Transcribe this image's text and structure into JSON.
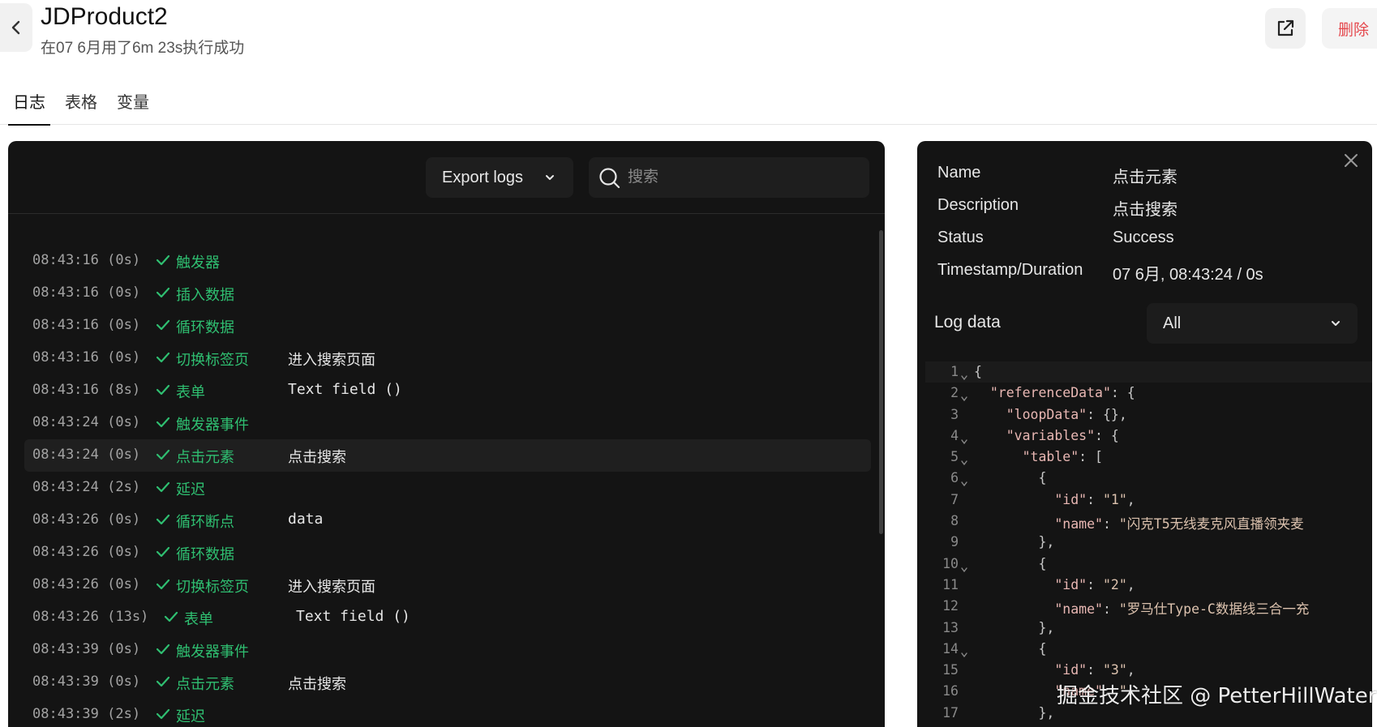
{
  "header": {
    "title": "JDProduct2",
    "subtitle": "在07 6月用了6m 23s执行成功",
    "delete_label": "删除"
  },
  "tabs": [
    {
      "label": "日志",
      "active": true
    },
    {
      "label": "表格",
      "active": false
    },
    {
      "label": "变量",
      "active": false
    }
  ],
  "log_panel": {
    "export_label": "Export logs",
    "search_placeholder": "搜索",
    "rows": [
      {
        "time": "08:43:16 (0s)",
        "step": "触发器",
        "detail": ""
      },
      {
        "time": "08:43:16 (0s)",
        "step": "插入数据",
        "detail": ""
      },
      {
        "time": "08:43:16 (0s)",
        "step": "循环数据",
        "detail": ""
      },
      {
        "time": "08:43:16 (0s)",
        "step": "切换标签页",
        "detail": "进入搜索页面"
      },
      {
        "time": "08:43:16 (8s)",
        "step": "表单",
        "detail": "Text field ()"
      },
      {
        "time": "08:43:24 (0s)",
        "step": "触发器事件",
        "detail": ""
      },
      {
        "time": "08:43:24 (0s)",
        "step": "点击元素",
        "detail": "点击搜索",
        "selected": true
      },
      {
        "time": "08:43:24 (2s)",
        "step": "延迟",
        "detail": ""
      },
      {
        "time": "08:43:26 (0s)",
        "step": "循环断点",
        "detail": "data"
      },
      {
        "time": "08:43:26 (0s)",
        "step": "循环数据",
        "detail": ""
      },
      {
        "time": "08:43:26 (0s)",
        "step": "切换标签页",
        "detail": "进入搜索页面"
      },
      {
        "time": "08:43:26 (13s)",
        "step": "表单",
        "detail": "Text field ()"
      },
      {
        "time": "08:43:39 (0s)",
        "step": "触发器事件",
        "detail": ""
      },
      {
        "time": "08:43:39 (0s)",
        "step": "点击元素",
        "detail": "点击搜索"
      },
      {
        "time": "08:43:39 (2s)",
        "step": "延迟",
        "detail": ""
      }
    ]
  },
  "details": {
    "name_label": "Name",
    "name_value": "点击元素",
    "description_label": "Description",
    "description_value": "点击搜索",
    "status_label": "Status",
    "status_value": "Success",
    "timestamp_label": "Timestamp/Duration",
    "timestamp_value": "07 6月, 08:43:24 / 0s",
    "log_data_label": "Log data",
    "log_data_filter": "All"
  },
  "code_lines": [
    {
      "n": "1",
      "fold": true,
      "text": "{"
    },
    {
      "n": "2",
      "fold": true,
      "text": "  \"referenceData\": {"
    },
    {
      "n": "3",
      "fold": false,
      "text": "    \"loopData\": {},"
    },
    {
      "n": "4",
      "fold": true,
      "text": "    \"variables\": {"
    },
    {
      "n": "5",
      "fold": true,
      "text": "      \"table\": ["
    },
    {
      "n": "6",
      "fold": true,
      "text": "        {"
    },
    {
      "n": "7",
      "fold": false,
      "text": "          \"id\": \"1\","
    },
    {
      "n": "8",
      "fold": false,
      "text": "          \"name\": \"闪克T5无线麦克风直播领夹麦"
    },
    {
      "n": "9",
      "fold": false,
      "text": "        },"
    },
    {
      "n": "10",
      "fold": true,
      "text": "        {"
    },
    {
      "n": "11",
      "fold": false,
      "text": "          \"id\": \"2\","
    },
    {
      "n": "12",
      "fold": false,
      "text": "          \"name\": \"罗马仕Type-C数据线三合一充"
    },
    {
      "n": "13",
      "fold": false,
      "text": "        },"
    },
    {
      "n": "14",
      "fold": true,
      "text": "        {"
    },
    {
      "n": "15",
      "fold": false,
      "text": "          \"id\": \"3\","
    },
    {
      "n": "16",
      "fold": false,
      "text": "          \"name\": \""
    },
    {
      "n": "17",
      "fold": false,
      "text": "        },"
    }
  ],
  "watermark": "掘金技术社区 @ PetterHillWater",
  "colors": {
    "success_green": "#2fbf71",
    "danger_red": "#e5484d",
    "panel_bg": "#141414"
  }
}
